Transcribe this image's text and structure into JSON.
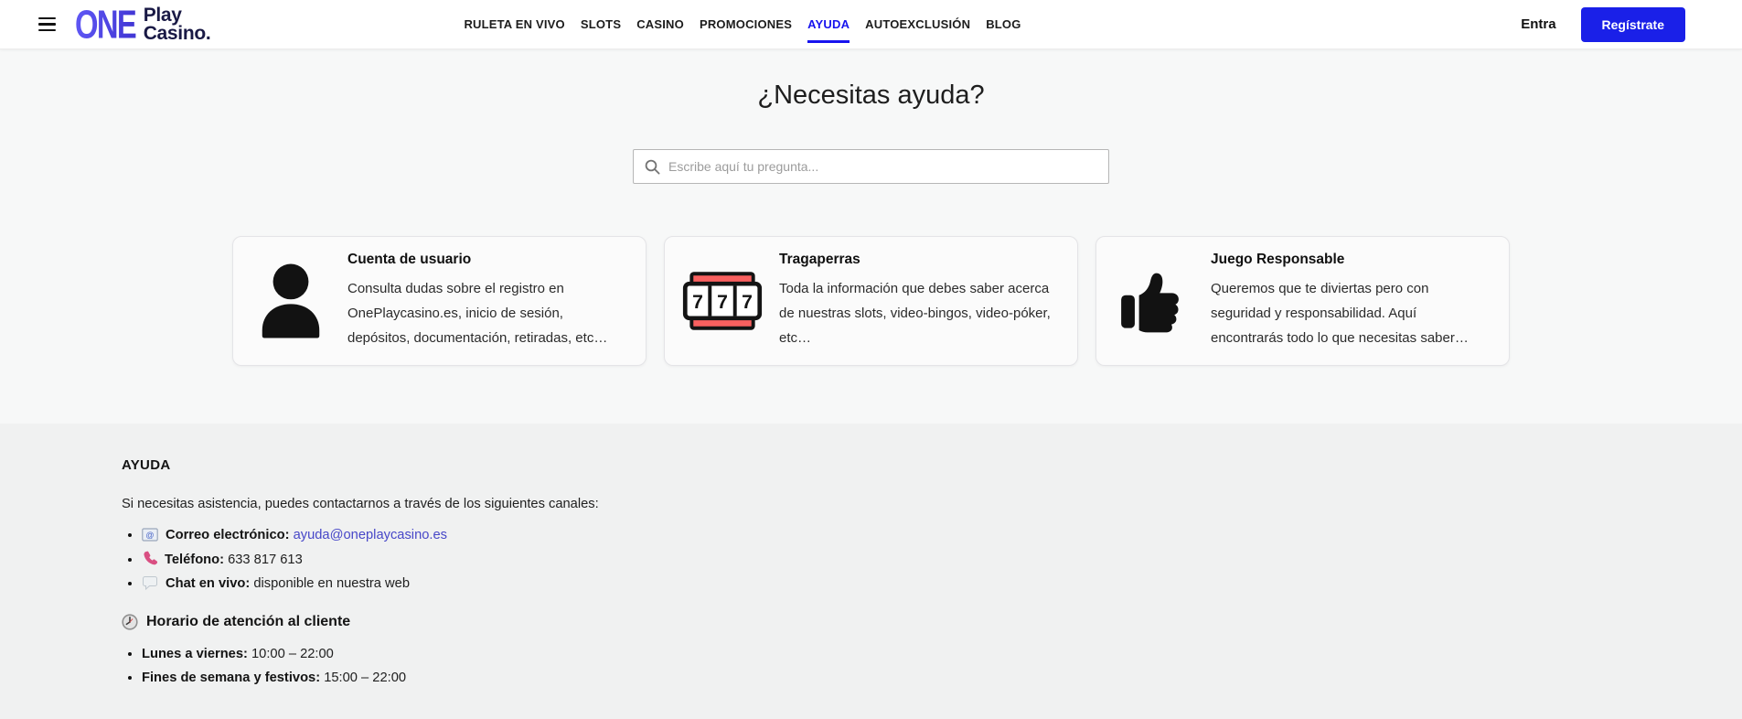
{
  "header": {
    "logo": {
      "one": "ONE",
      "play": "Play",
      "casino": "Casino."
    },
    "nav": [
      {
        "label": "RULETA EN VIVO",
        "active": false
      },
      {
        "label": "SLOTS",
        "active": false
      },
      {
        "label": "CASINO",
        "active": false
      },
      {
        "label": "PROMOCIONES",
        "active": false
      },
      {
        "label": "AYUDA",
        "active": true
      },
      {
        "label": "AUTOEXCLUSIÓN",
        "active": false
      },
      {
        "label": "BLOG",
        "active": false
      }
    ],
    "login_label": "Entra",
    "register_label": "Regístrate"
  },
  "help": {
    "title": "¿Necesitas ayuda?",
    "search_placeholder": "Escribe aquí tu pregunta...",
    "cards": [
      {
        "icon": "user-icon",
        "title": "Cuenta de usuario",
        "description": "Consulta dudas sobre el registro en OnePlaycasino.es, inicio de sesión, depósitos, documentación, retiradas, etc…"
      },
      {
        "icon": "slot-machine-icon",
        "icon_digit": "7",
        "title": "Tragaperras",
        "description": "Toda la información que debes saber acerca de nuestras slots, video-bingos, video-póker, etc…"
      },
      {
        "icon": "thumbs-up-icon",
        "title": "Juego Responsable",
        "description": "Queremos que te diviertas pero con seguridad y responsabilidad. Aquí encontrarás todo lo que necesitas saber…"
      }
    ]
  },
  "footer": {
    "title": "AYUDA",
    "intro": "Si necesitas asistencia, puedes contactarnos a través de los siguientes canales:",
    "contacts": [
      {
        "icon": "email-icon",
        "label": "Correo electrónico:",
        "value": "ayuda@oneplaycasino.es"
      },
      {
        "icon": "phone-icon",
        "label": "Teléfono:",
        "value": "633 817 613"
      },
      {
        "icon": "chat-icon",
        "label": "Chat en vivo:",
        "value": "disponible en nuestra web"
      }
    ],
    "schedule_title": "Horario de atención al cliente",
    "schedule": [
      {
        "label": "Lunes a viernes:",
        "value": "10:00 – 22:00"
      },
      {
        "label": "Fines de semana y festivos:",
        "value": "15:00 – 22:00"
      }
    ]
  },
  "colors": {
    "accent_blue": "#1713ee",
    "button_blue": "#1a20e8",
    "logo_navy": "#191945",
    "logo_gradient_start": "#5d55f2",
    "logo_gradient_end": "#4338d6",
    "link_blue": "#4747c8",
    "slot_red": "#f9605f",
    "phone_pink": "#d94f82",
    "footer_bg": "#f0f1f1",
    "main_bg": "#f7f8f8"
  }
}
